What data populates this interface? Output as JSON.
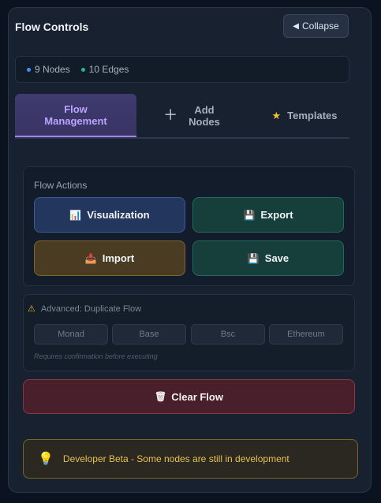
{
  "header": {
    "title": "Flow Controls",
    "collapse_label": "Collapse"
  },
  "stats": {
    "nodes": "9 Nodes",
    "edges": "10 Edges",
    "node_dot_color": "#4c8dff",
    "edge_dot_color": "#16c08a"
  },
  "tabs": [
    {
      "label_line1": "Flow",
      "label_line2": "Management",
      "active": true
    },
    {
      "label_line1": "Add",
      "label_line2": "Nodes",
      "icon": "plus-icon",
      "active": false
    },
    {
      "label": "Templates",
      "icon": "star-icon",
      "active": false
    }
  ],
  "flow_actions": {
    "title": "Flow Actions",
    "visualization_label": "Visualization",
    "export_label": "Export",
    "import_label": "Import",
    "save_label": "Save"
  },
  "advanced": {
    "title": "Advanced: Duplicate Flow",
    "chains": [
      "Monad",
      "Base",
      "Bsc",
      "Ethereum"
    ],
    "note": "Requires confirmation before executing"
  },
  "clear_label": "Clear Flow",
  "beta_notice": "Developer Beta - Some nodes are still in development"
}
